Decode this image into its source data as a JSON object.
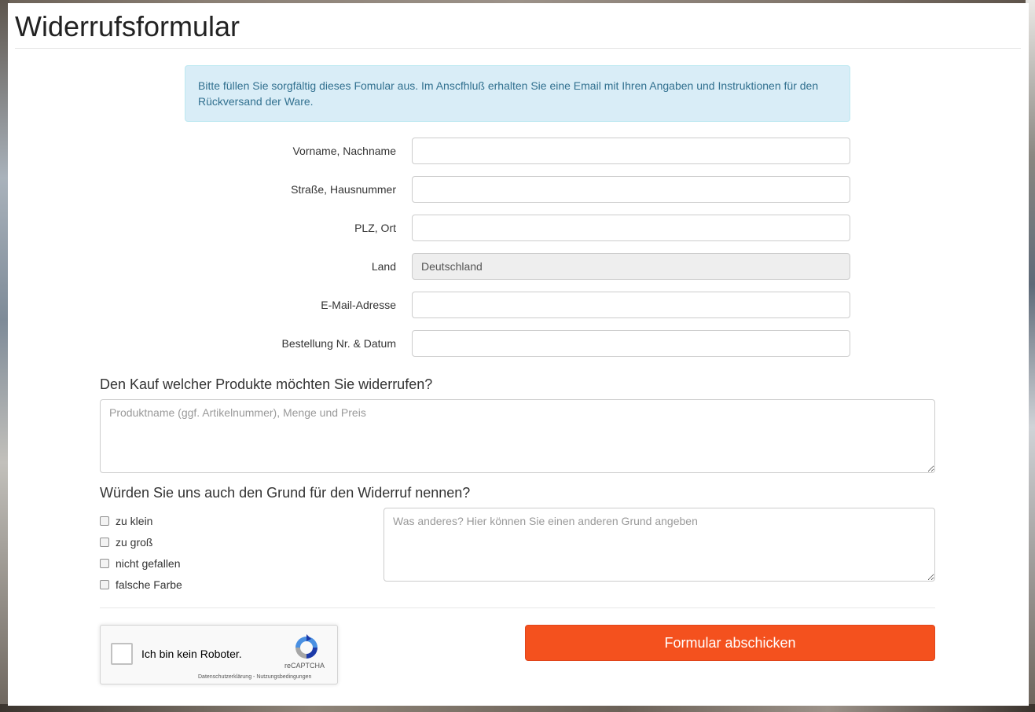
{
  "page": {
    "title": "Widerrufsformular"
  },
  "info": {
    "text": "Bitte füllen Sie sorgfältig dieses Fomular aus. Im Anscfhluß erhalten Sie eine Email mit Ihren Angaben und Instruktionen für den Rückversand der Ware."
  },
  "form": {
    "fields": [
      {
        "label": "Vorname, Nachname",
        "value": ""
      },
      {
        "label": "Straße, Hausnummer",
        "value": ""
      },
      {
        "label": "PLZ, Ort",
        "value": ""
      },
      {
        "label": "Land",
        "value": "Deutschland",
        "readonly": true
      },
      {
        "label": "E-Mail-Adresse",
        "value": ""
      },
      {
        "label": "Bestellung Nr. & Datum",
        "value": ""
      }
    ]
  },
  "products": {
    "heading": "Den Kauf welcher Produkte möchten Sie widerrufen?",
    "placeholder": "Produktname (ggf. Artikelnummer), Menge und Preis"
  },
  "reason": {
    "heading": "Würden Sie uns auch den Grund für den Widerruf nennen?",
    "options": [
      {
        "label": "zu klein",
        "checked": false
      },
      {
        "label": "zu groß",
        "checked": false
      },
      {
        "label": "nicht gefallen",
        "checked": false
      },
      {
        "label": "falsche Farbe",
        "checked": false
      }
    ],
    "other_placeholder": "Was anderes? Hier können Sie einen anderen Grund angeben"
  },
  "captcha": {
    "label": "Ich bin kein Roboter.",
    "brand": "reCAPTCHA",
    "links": "Datenschutzerklärung - Nutzungsbedingungen"
  },
  "submit": {
    "label": "Formular abschicken",
    "color": "#f4511e"
  },
  "colors": {
    "info_bg": "#d9edf7",
    "info_text": "#31708f"
  }
}
